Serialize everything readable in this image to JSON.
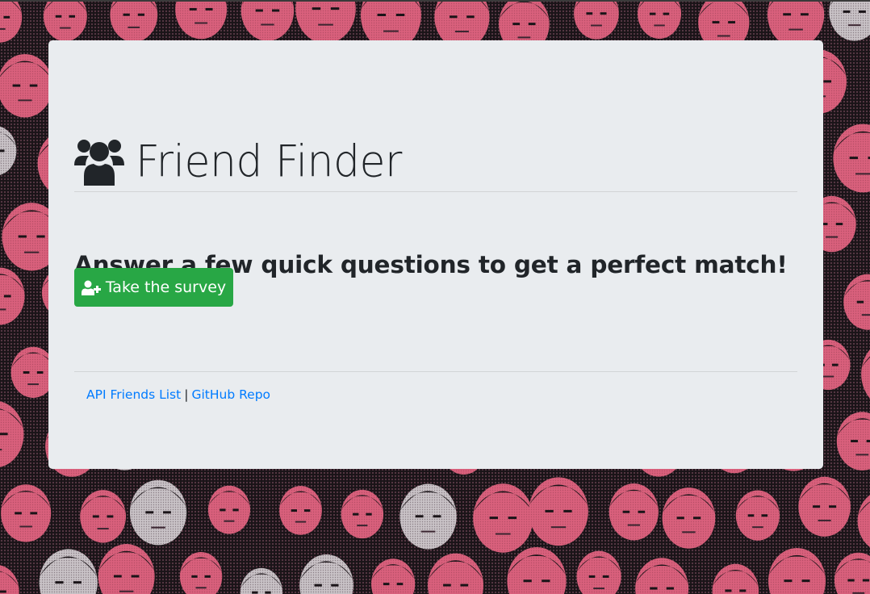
{
  "header": {
    "title": "Friend Finder",
    "icon": "users-icon"
  },
  "main": {
    "lead": "Answer a few quick questions to get a perfect match!",
    "survey_button": {
      "label": "Take the survey",
      "icon": "user-plus-icon"
    }
  },
  "footer": {
    "links": [
      {
        "label": "API Friends List"
      },
      {
        "label": "GitHub Repo"
      }
    ],
    "separator": "|"
  },
  "colors": {
    "card_background": "#e9ecef",
    "button_success": "#28a745",
    "link": "#007bff",
    "text": "#212529",
    "background_pink": "#d9607c",
    "background_dark": "#1a1418"
  }
}
